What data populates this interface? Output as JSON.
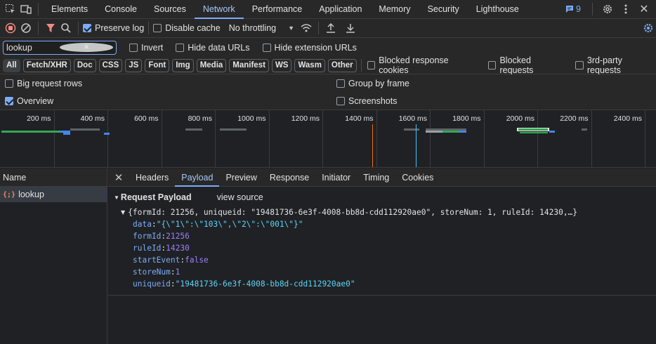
{
  "top_tabs": [
    "Elements",
    "Console",
    "Sources",
    "Network",
    "Performance",
    "Application",
    "Memory",
    "Security",
    "Lighthouse"
  ],
  "active_tab": "Network",
  "issues_count": "9",
  "toolbar": {
    "preserve_log": "Preserve log",
    "disable_cache": "Disable cache",
    "throttling": "No throttling"
  },
  "filter": {
    "value": "lookup",
    "invert": "Invert",
    "hide_data_urls": "Hide data URLs",
    "hide_extension_urls": "Hide extension URLs"
  },
  "type_chips": [
    "All",
    "Fetch/XHR",
    "Doc",
    "CSS",
    "JS",
    "Font",
    "Img",
    "Media",
    "Manifest",
    "WS",
    "Wasm",
    "Other"
  ],
  "type_filters": {
    "blocked_response_cookies": "Blocked response cookies",
    "blocked_requests": "Blocked requests",
    "third_party": "3rd-party requests"
  },
  "settings": {
    "big_request_rows": "Big request rows",
    "group_by_frame": "Group by frame",
    "overview": "Overview",
    "screenshots": "Screenshots"
  },
  "timeline_ticks": [
    "200 ms",
    "400 ms",
    "600 ms",
    "800 ms",
    "1000 ms",
    "1200 ms",
    "1400 ms",
    "1600 ms",
    "1800 ms",
    "2000 ms",
    "2200 ms",
    "2400 ms"
  ],
  "name_header": "Name",
  "request_name": "lookup",
  "detail_tabs": [
    "Headers",
    "Payload",
    "Preview",
    "Response",
    "Initiator",
    "Timing",
    "Cookies"
  ],
  "active_detail_tab": "Payload",
  "payload": {
    "title": "Request Payload",
    "view_source": "view source",
    "summary": "{formId: 21256, uniqueid: \"19481736-6e3f-4008-bb8d-cdd112920ae0\", storeNum: 1, ruleId: 14230,…}",
    "fields": [
      {
        "key": "data",
        "value": "\"{\\\"1\\\":\\\"103\\\",\\\"2\\\":\\\"001\\\"}\"",
        "kind": "str"
      },
      {
        "key": "formId",
        "value": "21256",
        "kind": "num"
      },
      {
        "key": "ruleId",
        "value": "14230",
        "kind": "num"
      },
      {
        "key": "startEvent",
        "value": "false",
        "kind": "bool"
      },
      {
        "key": "storeNum",
        "value": "1",
        "kind": "num"
      },
      {
        "key": "uniqueid",
        "value": "\"19481736-6e3f-4008-bb8d-cdd112920ae0\"",
        "kind": "str"
      }
    ]
  },
  "colors": {
    "accent": "#7cacf8",
    "record_red": "#f28b82",
    "filter_red": "#f28b82",
    "string": "#5cd5fb",
    "number": "#9980ff",
    "bar_green": "#34a853",
    "bar_blue": "#4285f4",
    "marker_orange": "#e8710a",
    "marker_cyan": "#40c4ff"
  }
}
